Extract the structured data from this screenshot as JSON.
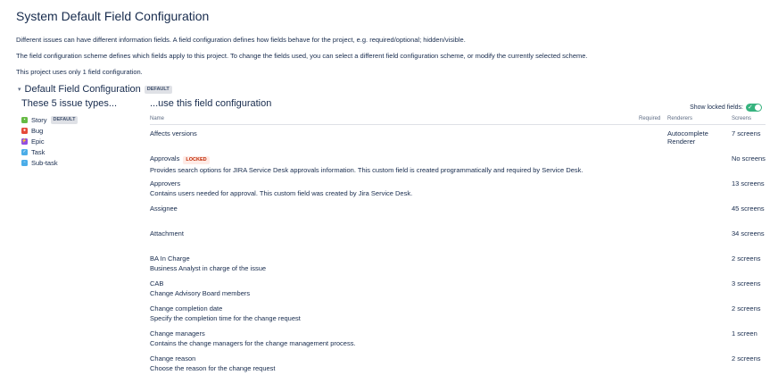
{
  "page": {
    "title": "System Default Field Configuration",
    "desc1": "Different issues can have different information fields. A field configuration defines how fields behave for the project, e.g. required/optional; hidden/visible.",
    "desc2": "The field configuration scheme defines which fields apply to this project. To change the fields used, you can select a different field configuration scheme, or modify the currently selected scheme.",
    "desc3": "This project uses only 1 field configuration."
  },
  "section": {
    "title": "Default Field Configuration",
    "badge": "DEFAULT"
  },
  "issue_types": {
    "heading": "These 5 issue types...",
    "default_badge": "DEFAULT",
    "items": [
      {
        "label": "Story",
        "color": "#65ba43"
      },
      {
        "label": "Bug",
        "color": "#e5493a"
      },
      {
        "label": "Epic",
        "color": "#904ee2"
      },
      {
        "label": "Task",
        "color": "#4bade8"
      },
      {
        "label": "Sub-task",
        "color": "#4bade8"
      }
    ]
  },
  "fields": {
    "heading": "...use this field configuration",
    "show_locked_label": "Show locked fields:",
    "locked_badge": "LOCKED",
    "columns": {
      "name": "Name",
      "required": "Required",
      "renderers": "Renderers",
      "screens": "Screens"
    },
    "rows": [
      {
        "name": "Affects versions",
        "desc": "",
        "renderer": "Autocomplete Renderer",
        "screens": "7 screens"
      },
      {
        "name": "Approvals",
        "desc": "Provides search options for JIRA Service Desk approvals information. This custom field is created programmatically and required by Service Desk.",
        "renderer": "",
        "screens": "No screens"
      },
      {
        "name": "Approvers",
        "desc": "Contains users needed for approval. This custom field was created by Jira Service Desk.",
        "renderer": "",
        "screens": "13 screens"
      },
      {
        "name": "Assignee",
        "desc": "",
        "renderer": "",
        "screens": "45 screens"
      },
      {
        "name": "Attachment",
        "desc": "",
        "renderer": "",
        "screens": "34 screens"
      },
      {
        "name": "BA In Charge",
        "desc": "Business Analyst in charge of the issue",
        "renderer": "",
        "screens": "2 screens"
      },
      {
        "name": "CAB",
        "desc": "Change Advisory Board members",
        "renderer": "",
        "screens": "3 screens"
      },
      {
        "name": "Change completion date",
        "desc": "Specify the completion time for the change request",
        "renderer": "",
        "screens": "2 screens"
      },
      {
        "name": "Change managers",
        "desc": "Contains the change managers for the change management process.",
        "renderer": "",
        "screens": "1 screen"
      },
      {
        "name": "Change reason",
        "desc": "Choose the reason for the change request",
        "renderer": "",
        "screens": "2 screens"
      }
    ]
  }
}
